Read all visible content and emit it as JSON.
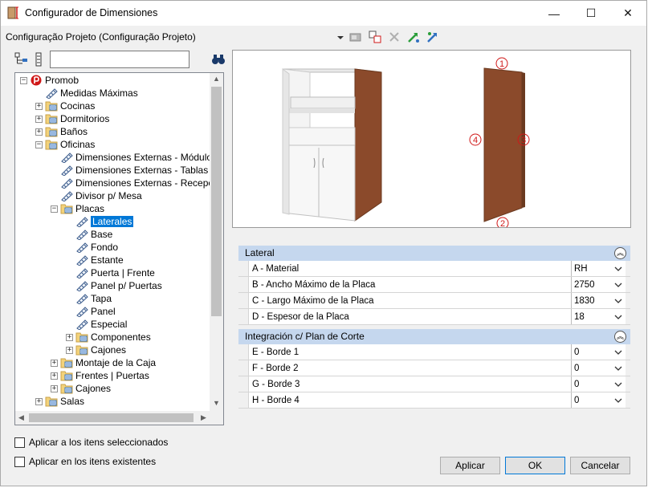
{
  "window": {
    "title": "Configurador de Dimensiones",
    "minimize_glyph": "—",
    "maximize_glyph": "☐",
    "close_glyph": "✕"
  },
  "config": {
    "current": "Configuração Projeto (Configuração Projeto)"
  },
  "tree": {
    "search_value": "",
    "items": [
      {
        "label": "Promob",
        "level": 0,
        "expander": "−",
        "icon": "promob-logo-icon"
      },
      {
        "label": "Medidas Máximas",
        "level": 1,
        "expander": "",
        "icon": "ruler-icon"
      },
      {
        "label": "Cocinas",
        "level": 1,
        "expander": "+",
        "icon": "folder-icon"
      },
      {
        "label": "Dormitorios",
        "level": 1,
        "expander": "+",
        "icon": "folder-icon"
      },
      {
        "label": "Baños",
        "level": 1,
        "expander": "+",
        "icon": "folder-icon"
      },
      {
        "label": "Oficinas",
        "level": 1,
        "expander": "−",
        "icon": "folder-icon"
      },
      {
        "label": "Dimensiones Externas - Módulos",
        "level": 2,
        "expander": "",
        "icon": "ruler-icon"
      },
      {
        "label": "Dimensiones Externas - Tablas",
        "level": 2,
        "expander": "",
        "icon": "ruler-icon"
      },
      {
        "label": "Dimensiones Externas - Recepción",
        "level": 2,
        "expander": "",
        "icon": "ruler-icon"
      },
      {
        "label": "Divisor p/ Mesa",
        "level": 2,
        "expander": "",
        "icon": "ruler-icon"
      },
      {
        "label": "Placas",
        "level": 2,
        "expander": "−",
        "icon": "folder-icon"
      },
      {
        "label": "Laterales",
        "level": 3,
        "expander": "",
        "icon": "ruler-icon",
        "selected": true
      },
      {
        "label": "Base",
        "level": 3,
        "expander": "",
        "icon": "ruler-icon"
      },
      {
        "label": "Fondo",
        "level": 3,
        "expander": "",
        "icon": "ruler-icon"
      },
      {
        "label": "Estante",
        "level": 3,
        "expander": "",
        "icon": "ruler-icon"
      },
      {
        "label": "Puerta | Frente",
        "level": 3,
        "expander": "",
        "icon": "ruler-icon"
      },
      {
        "label": "Panel p/ Puertas",
        "level": 3,
        "expander": "",
        "icon": "ruler-icon"
      },
      {
        "label": "Tapa",
        "level": 3,
        "expander": "",
        "icon": "ruler-icon"
      },
      {
        "label": "Panel",
        "level": 3,
        "expander": "",
        "icon": "ruler-icon"
      },
      {
        "label": "Especial",
        "level": 3,
        "expander": "",
        "icon": "ruler-icon"
      },
      {
        "label": "Componentes",
        "level": 3,
        "expander": "+",
        "icon": "folder-icon"
      },
      {
        "label": "Cajones",
        "level": 3,
        "expander": "+",
        "icon": "folder-icon"
      },
      {
        "label": "Montaje de la Caja",
        "level": 2,
        "expander": "+",
        "icon": "folder-icon"
      },
      {
        "label": "Frentes | Puertas",
        "level": 2,
        "expander": "+",
        "icon": "folder-icon"
      },
      {
        "label": "Cajones",
        "level": 2,
        "expander": "+",
        "icon": "folder-icon"
      },
      {
        "label": "Salas",
        "level": 1,
        "expander": "+",
        "icon": "folder-icon"
      }
    ]
  },
  "preview": {
    "markers": [
      "1",
      "2",
      "3",
      "4"
    ]
  },
  "groups": [
    {
      "title": "Lateral",
      "collapse_glyph": "︽",
      "rows": [
        {
          "name": "A - Material",
          "value": "RH"
        },
        {
          "name": "B -  Ancho Máximo de la Placa",
          "value": "2750"
        },
        {
          "name": "C - Largo Máximo de la Placa",
          "value": "1830"
        },
        {
          "name": "D - Espesor de la Placa",
          "value": "18"
        }
      ]
    },
    {
      "title": "Integración c/ Plan de Corte",
      "collapse_glyph": "︽",
      "rows": [
        {
          "name": "E - Borde 1",
          "value": "0"
        },
        {
          "name": "F - Borde 2",
          "value": "0"
        },
        {
          "name": "G - Borde 3",
          "value": "0"
        },
        {
          "name": "H - Borde 4",
          "value": "0"
        }
      ]
    }
  ],
  "options": {
    "apply_selected": "Aplicar a los itens seleccionados",
    "apply_existing": "Aplicar en los itens existentes"
  },
  "buttons": {
    "apply": "Aplicar",
    "ok": "OK",
    "cancel": "Cancelar"
  },
  "colors": {
    "wood": "#8b4a2b",
    "group_header": "#c5d7ee",
    "selection": "#0078d7",
    "marker": "#d01818"
  }
}
